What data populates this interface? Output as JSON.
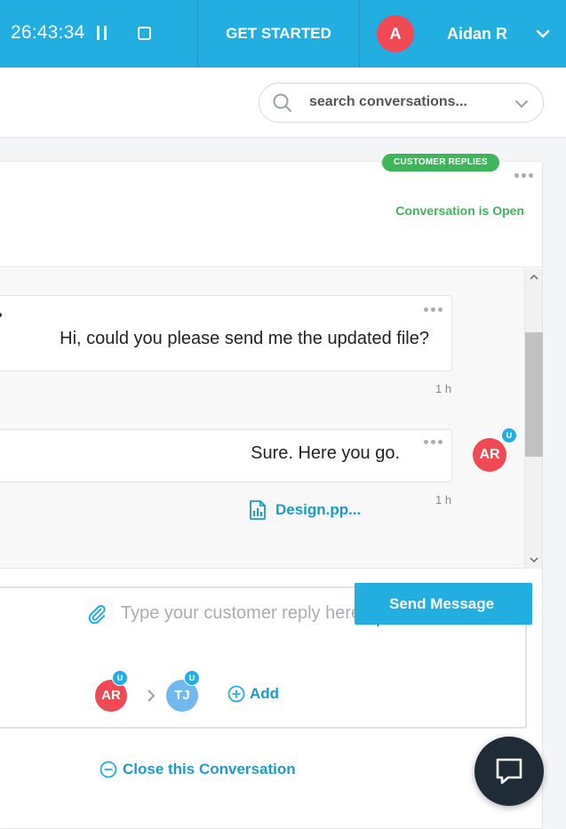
{
  "topbar": {
    "timer": "26:43:34",
    "get_started_label": "GET STARTED",
    "user_initial": "A",
    "user_name": "Aidan R",
    "icons": [
      "pause-icon",
      "stop-icon",
      "chevron-down-icon"
    ],
    "color": "#22aee0"
  },
  "search": {
    "placeholder": "search conversations...",
    "icons": [
      "search-icon",
      "chevron-down-icon"
    ]
  },
  "conversation": {
    "badge": "CUSTOMER REPLIES",
    "status": "Conversation is Open",
    "status_color": "#3eb55b",
    "messages": [
      {
        "text": "Hi, could you please send me the updated file?",
        "time": "1 h"
      },
      {
        "text": "Sure. Here you go.",
        "time": "1 h",
        "avatar": "AR",
        "avatar_badge": "U",
        "attachment": "Design.pp..."
      }
    ]
  },
  "reply": {
    "placeholder": "Type your customer reply here...",
    "participants": [
      {
        "initials": "AR",
        "badge": "U",
        "color": "#ef4a54"
      },
      {
        "initials": "TJ",
        "badge": "U",
        "color": "#6fb8f0"
      }
    ],
    "add_label": "Add"
  },
  "actions": {
    "close_label": "Close this Conversation",
    "send_label": "Send Message"
  }
}
